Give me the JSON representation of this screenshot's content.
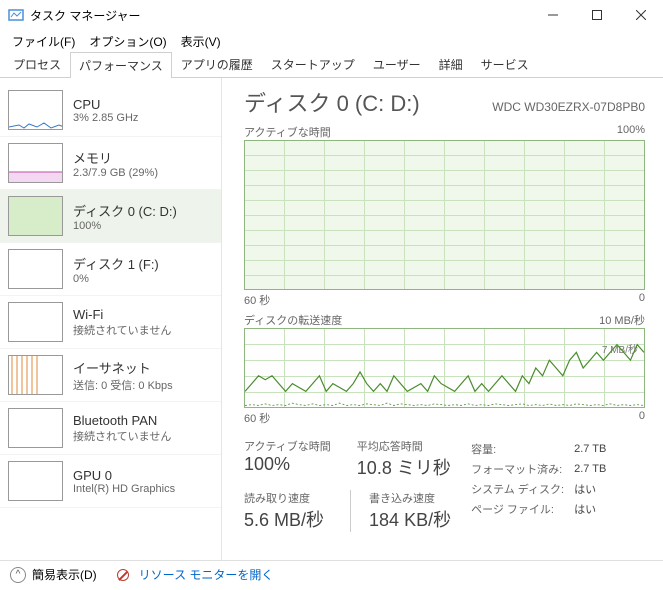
{
  "window": {
    "title": "タスク マネージャー"
  },
  "menu": {
    "file": "ファイル(F)",
    "options": "オプション(O)",
    "view": "表示(V)"
  },
  "tabs": {
    "processes": "プロセス",
    "performance": "パフォーマンス",
    "apphistory": "アプリの履歴",
    "startup": "スタートアップ",
    "users": "ユーザー",
    "details": "詳細",
    "services": "サービス"
  },
  "sidebar": [
    {
      "name": "CPU",
      "sub": "3%  2.85 GHz"
    },
    {
      "name": "メモリ",
      "sub": "2.3/7.9 GB (29%)"
    },
    {
      "name": "ディスク 0 (C: D:)",
      "sub": "100%"
    },
    {
      "name": "ディスク 1 (F:)",
      "sub": "0%"
    },
    {
      "name": "Wi-Fi",
      "sub": "接続されていません"
    },
    {
      "name": "イーサネット",
      "sub": "送信: 0 受信: 0 Kbps"
    },
    {
      "name": "Bluetooth PAN",
      "sub": "接続されていません"
    },
    {
      "name": "GPU 0",
      "sub": "Intel(R) HD Graphics"
    }
  ],
  "detail": {
    "title": "ディスク 0 (C: D:)",
    "model": "WDC WD30EZRX-07D8PB0",
    "chart1": {
      "label": "アクティブな時間",
      "max": "100%",
      "x_left": "60 秒",
      "x_right": "0"
    },
    "chart2": {
      "label": "ディスクの転送速度",
      "max": "10 MB/秒",
      "annotation": "7 MB/秒",
      "x_left": "60 秒",
      "x_right": "0"
    },
    "metrics": {
      "active_label": "アクティブな時間",
      "active_value": "100%",
      "resp_label": "平均応答時間",
      "resp_value": "10.8 ミリ秒",
      "read_label": "読み取り速度",
      "read_value": "5.6 MB/秒",
      "write_label": "書き込み速度",
      "write_value": "184 KB/秒"
    },
    "info": {
      "capacity_l": "容量:",
      "capacity_v": "2.7 TB",
      "formatted_l": "フォーマット済み:",
      "formatted_v": "2.7 TB",
      "sysdisk_l": "システム ディスク:",
      "sysdisk_v": "はい",
      "pagefile_l": "ページ ファイル:",
      "pagefile_v": "はい"
    }
  },
  "bottom": {
    "simple": "簡易表示(D)",
    "monitor": "リソース モニターを開く"
  },
  "chart_data": [
    {
      "type": "area",
      "title": "アクティブな時間",
      "ylabel": "%",
      "ylim": [
        0,
        100
      ],
      "xlabel": "秒",
      "xlim": [
        60,
        0
      ],
      "values": [
        100,
        100,
        100,
        100,
        100,
        100,
        100,
        100,
        100,
        100,
        100,
        100,
        100,
        100,
        100,
        100,
        100,
        100,
        100,
        100,
        100,
        100,
        100,
        100,
        100,
        100,
        100,
        100,
        100,
        100,
        100,
        100,
        100,
        100,
        100,
        100,
        100,
        100,
        100,
        100,
        100,
        100,
        100,
        100,
        100,
        100,
        100,
        100,
        100,
        100,
        100,
        100,
        100,
        100,
        100,
        100,
        100,
        100,
        100,
        100
      ]
    },
    {
      "type": "line",
      "title": "ディスクの転送速度",
      "ylabel": "MB/秒",
      "ylim": [
        0,
        10
      ],
      "xlabel": "秒",
      "xlim": [
        60,
        0
      ],
      "series": [
        {
          "name": "read",
          "values": [
            2,
            3,
            4,
            3.5,
            4,
            3,
            2,
            3,
            2.5,
            2,
            3,
            4,
            2,
            3,
            2.5,
            2,
            3,
            4.5,
            3,
            2,
            3,
            2,
            4,
            3,
            2,
            2.5,
            3,
            2,
            4,
            3,
            2.5,
            2,
            3,
            4,
            2,
            3,
            2,
            3,
            4,
            3,
            2,
            4,
            3,
            5,
            4,
            6,
            5,
            4,
            6,
            7,
            5,
            6,
            7,
            6,
            7,
            8,
            7,
            6,
            8,
            7
          ]
        },
        {
          "name": "write",
          "values": [
            0.2,
            0.3,
            0.2,
            0.4,
            0.2,
            0.3,
            0.2,
            0.5,
            0.3,
            0.2,
            0.4,
            0.2,
            0.3,
            0.2,
            0.5,
            0.2,
            0.3,
            0.2,
            0.4,
            0.3,
            0.2,
            0.5,
            0.2,
            0.4,
            0.3,
            0.2,
            0.3,
            0.2,
            0.4,
            0.3,
            0.2,
            0.3,
            0.2,
            0.4,
            0.2,
            0.3,
            0.2,
            0.4,
            0.3,
            0.2,
            0.3,
            0.4,
            0.2,
            0.3,
            0.2,
            0.4,
            0.2,
            0.3,
            0.2,
            0.4,
            0.3,
            0.2,
            0.3,
            0.2,
            0.4,
            0.2,
            0.3,
            0.2,
            0.3,
            0.2
          ]
        }
      ],
      "annotation": "7 MB/秒"
    }
  ]
}
